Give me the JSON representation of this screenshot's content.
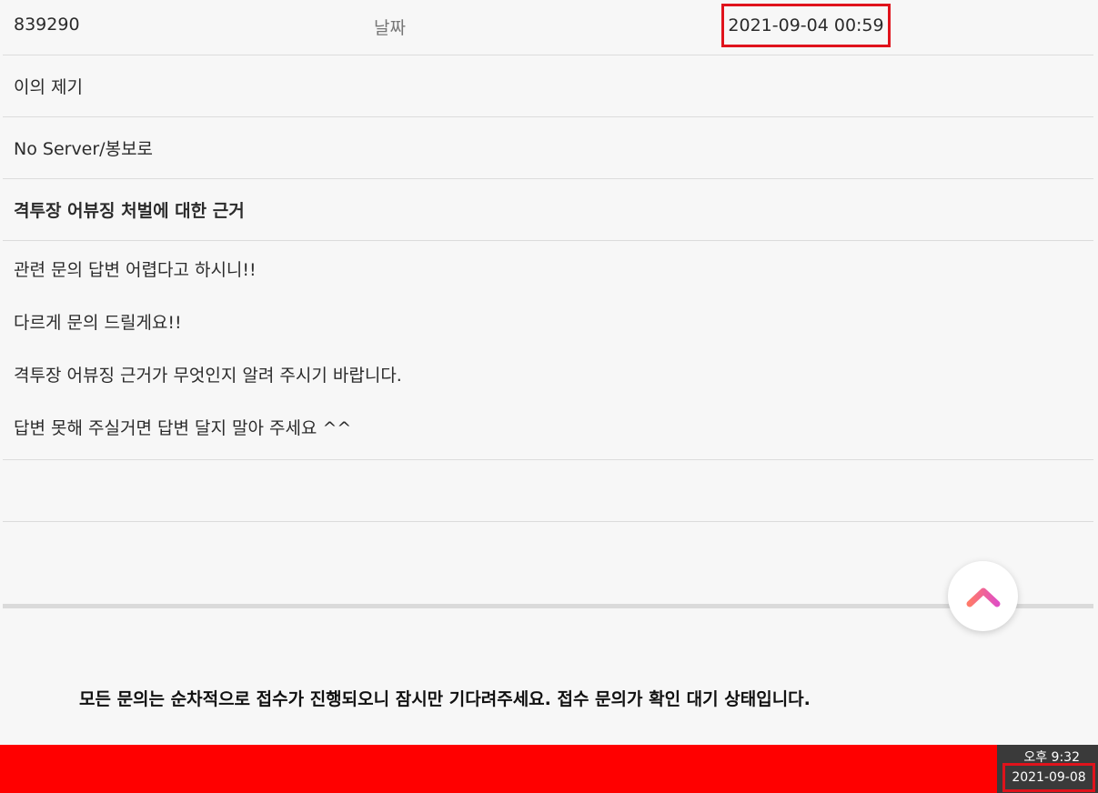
{
  "post": {
    "id": "839290",
    "date_label": "날짜",
    "date_value": "2021-09-04 00:59",
    "category": "이의 제기",
    "server": "No Server/봉보로",
    "title": "격투장 어뷰징 처벌에 대한 근거",
    "body_lines": [
      "관련 문의 답변 어렵다고 하시니!!",
      "다르게 문의 드릴게요!!",
      "격투장 어뷰징 근거가 무엇인지 알려 주시기 바랍니다.",
      "답변 못해 주실거면 답변 달지 말아 주세요 ^^"
    ]
  },
  "notice": "모든 문의는 순차적으로 접수가 진행되오니 잠시만 기다려주세요. 접수 문의가 확인 대기 상태입니다.",
  "scroll_top_button": {
    "icon": "chevron-up-icon",
    "gradient": [
      "#ff7a6b",
      "#e04fc2"
    ]
  },
  "taskbar": {
    "color": "#ff0000",
    "time": "오후 9:32",
    "date": "2021-09-08"
  }
}
